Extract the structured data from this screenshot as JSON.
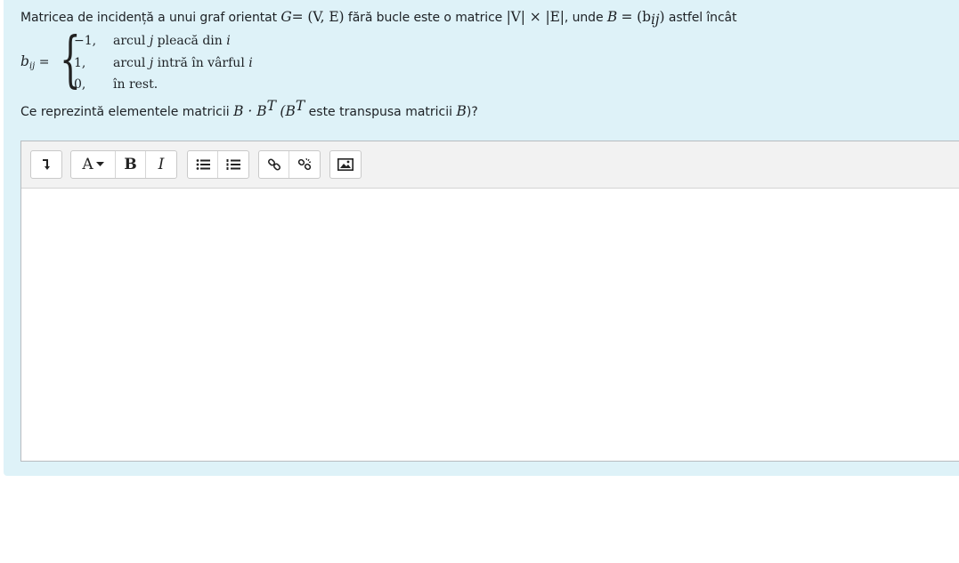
{
  "question": {
    "intro": "Matricea de incidență a unui graf orientat",
    "G": "G",
    "eq_ve": "= (V, E)",
    "fara_bucle": "fără bucle este o matrice",
    "dims": "|V| × |E|",
    "unde": ", unde",
    "B": "B",
    "eq_bij": "= (b",
    "ij": "ij",
    "close_paren": ")",
    "astfel": "astfel încât",
    "cases": {
      "lhs_b": "b",
      "lhs_sub": "ij",
      "lhs_eq": "=",
      "rows": [
        {
          "value": "−1,",
          "text_a": "arcul",
          "var_a": "j",
          "text_b": "pleacă din",
          "var_b": "i"
        },
        {
          "value": "1,",
          "text_a": "arcul",
          "var_a": "j",
          "text_b": "intră în vârful",
          "var_b": "i"
        },
        {
          "value": "0,",
          "text_a": "în rest.",
          "var_a": "",
          "text_b": "",
          "var_b": ""
        }
      ]
    },
    "q2_prefix": "Ce reprezintă elementele matricii",
    "q2_expr": "B · B",
    "q2_T": "T",
    "q2_open": "(B",
    "q2_T2": "T",
    "q2_mid": "este transpusa matricii",
    "q2_B": "B",
    "q2_end": ")?"
  },
  "toolbar": {
    "buttons": [
      {
        "name": "collapse-toggle-icon"
      },
      {
        "name": "font-style-dropdown",
        "label": "A"
      },
      {
        "name": "bold-button",
        "label": "B"
      },
      {
        "name": "italic-button",
        "label": "I"
      },
      {
        "name": "unordered-list-icon"
      },
      {
        "name": "ordered-list-icon"
      },
      {
        "name": "link-icon"
      },
      {
        "name": "unlink-icon"
      },
      {
        "name": "image-icon"
      }
    ]
  },
  "editor": {
    "content": ""
  }
}
